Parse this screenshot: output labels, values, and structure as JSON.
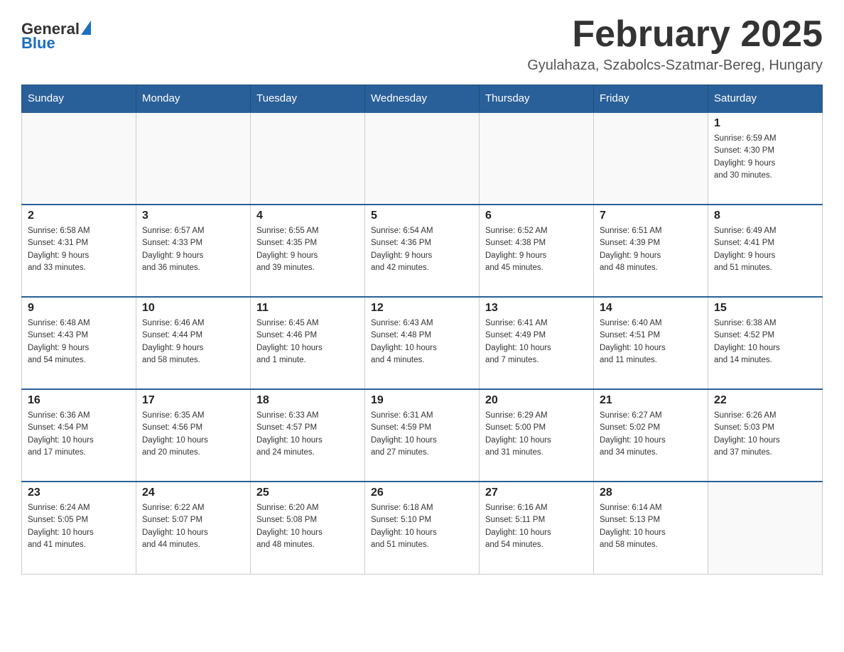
{
  "logo": {
    "text_general": "General",
    "text_blue": "Blue"
  },
  "header": {
    "title": "February 2025",
    "subtitle": "Gyulahaza, Szabolcs-Szatmar-Bereg, Hungary"
  },
  "weekdays": [
    "Sunday",
    "Monday",
    "Tuesday",
    "Wednesday",
    "Thursday",
    "Friday",
    "Saturday"
  ],
  "weeks": [
    [
      {
        "day": "",
        "info": ""
      },
      {
        "day": "",
        "info": ""
      },
      {
        "day": "",
        "info": ""
      },
      {
        "day": "",
        "info": ""
      },
      {
        "day": "",
        "info": ""
      },
      {
        "day": "",
        "info": ""
      },
      {
        "day": "1",
        "info": "Sunrise: 6:59 AM\nSunset: 4:30 PM\nDaylight: 9 hours\nand 30 minutes."
      }
    ],
    [
      {
        "day": "2",
        "info": "Sunrise: 6:58 AM\nSunset: 4:31 PM\nDaylight: 9 hours\nand 33 minutes."
      },
      {
        "day": "3",
        "info": "Sunrise: 6:57 AM\nSunset: 4:33 PM\nDaylight: 9 hours\nand 36 minutes."
      },
      {
        "day": "4",
        "info": "Sunrise: 6:55 AM\nSunset: 4:35 PM\nDaylight: 9 hours\nand 39 minutes."
      },
      {
        "day": "5",
        "info": "Sunrise: 6:54 AM\nSunset: 4:36 PM\nDaylight: 9 hours\nand 42 minutes."
      },
      {
        "day": "6",
        "info": "Sunrise: 6:52 AM\nSunset: 4:38 PM\nDaylight: 9 hours\nand 45 minutes."
      },
      {
        "day": "7",
        "info": "Sunrise: 6:51 AM\nSunset: 4:39 PM\nDaylight: 9 hours\nand 48 minutes."
      },
      {
        "day": "8",
        "info": "Sunrise: 6:49 AM\nSunset: 4:41 PM\nDaylight: 9 hours\nand 51 minutes."
      }
    ],
    [
      {
        "day": "9",
        "info": "Sunrise: 6:48 AM\nSunset: 4:43 PM\nDaylight: 9 hours\nand 54 minutes."
      },
      {
        "day": "10",
        "info": "Sunrise: 6:46 AM\nSunset: 4:44 PM\nDaylight: 9 hours\nand 58 minutes."
      },
      {
        "day": "11",
        "info": "Sunrise: 6:45 AM\nSunset: 4:46 PM\nDaylight: 10 hours\nand 1 minute."
      },
      {
        "day": "12",
        "info": "Sunrise: 6:43 AM\nSunset: 4:48 PM\nDaylight: 10 hours\nand 4 minutes."
      },
      {
        "day": "13",
        "info": "Sunrise: 6:41 AM\nSunset: 4:49 PM\nDaylight: 10 hours\nand 7 minutes."
      },
      {
        "day": "14",
        "info": "Sunrise: 6:40 AM\nSunset: 4:51 PM\nDaylight: 10 hours\nand 11 minutes."
      },
      {
        "day": "15",
        "info": "Sunrise: 6:38 AM\nSunset: 4:52 PM\nDaylight: 10 hours\nand 14 minutes."
      }
    ],
    [
      {
        "day": "16",
        "info": "Sunrise: 6:36 AM\nSunset: 4:54 PM\nDaylight: 10 hours\nand 17 minutes."
      },
      {
        "day": "17",
        "info": "Sunrise: 6:35 AM\nSunset: 4:56 PM\nDaylight: 10 hours\nand 20 minutes."
      },
      {
        "day": "18",
        "info": "Sunrise: 6:33 AM\nSunset: 4:57 PM\nDaylight: 10 hours\nand 24 minutes."
      },
      {
        "day": "19",
        "info": "Sunrise: 6:31 AM\nSunset: 4:59 PM\nDaylight: 10 hours\nand 27 minutes."
      },
      {
        "day": "20",
        "info": "Sunrise: 6:29 AM\nSunset: 5:00 PM\nDaylight: 10 hours\nand 31 minutes."
      },
      {
        "day": "21",
        "info": "Sunrise: 6:27 AM\nSunset: 5:02 PM\nDaylight: 10 hours\nand 34 minutes."
      },
      {
        "day": "22",
        "info": "Sunrise: 6:26 AM\nSunset: 5:03 PM\nDaylight: 10 hours\nand 37 minutes."
      }
    ],
    [
      {
        "day": "23",
        "info": "Sunrise: 6:24 AM\nSunset: 5:05 PM\nDaylight: 10 hours\nand 41 minutes."
      },
      {
        "day": "24",
        "info": "Sunrise: 6:22 AM\nSunset: 5:07 PM\nDaylight: 10 hours\nand 44 minutes."
      },
      {
        "day": "25",
        "info": "Sunrise: 6:20 AM\nSunset: 5:08 PM\nDaylight: 10 hours\nand 48 minutes."
      },
      {
        "day": "26",
        "info": "Sunrise: 6:18 AM\nSunset: 5:10 PM\nDaylight: 10 hours\nand 51 minutes."
      },
      {
        "day": "27",
        "info": "Sunrise: 6:16 AM\nSunset: 5:11 PM\nDaylight: 10 hours\nand 54 minutes."
      },
      {
        "day": "28",
        "info": "Sunrise: 6:14 AM\nSunset: 5:13 PM\nDaylight: 10 hours\nand 58 minutes."
      },
      {
        "day": "",
        "info": ""
      }
    ]
  ]
}
